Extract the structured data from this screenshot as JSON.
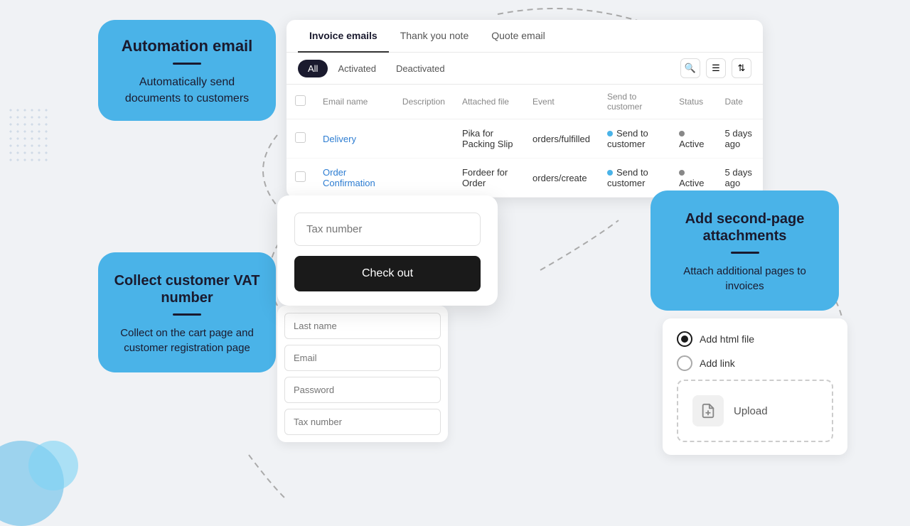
{
  "automation": {
    "label_title": "Automation email",
    "label_desc": "Automatically send documents to customers",
    "panel": {
      "tabs": [
        {
          "label": "Invoice emails",
          "active": true
        },
        {
          "label": "Thank you note",
          "active": false
        },
        {
          "label": "Quote email",
          "active": false
        }
      ],
      "filters": [
        {
          "label": "All",
          "active": true
        },
        {
          "label": "Activated",
          "active": false
        },
        {
          "label": "Deactivated",
          "active": false
        }
      ],
      "columns": [
        "Email name",
        "Description",
        "Attached file",
        "Event",
        "Send to customer",
        "Status",
        "Date"
      ],
      "rows": [
        {
          "name": "Delivery",
          "description": "",
          "attached_file": "Pika for Packing Slip",
          "event": "orders/fulfilled",
          "send_to": "Send to customer",
          "status": "Active",
          "date": "5 days ago"
        },
        {
          "name": "Order Confirmation",
          "description": "",
          "attached_file": "Fordeer for Order",
          "event": "orders/create",
          "send_to": "Send to customer",
          "status": "Active",
          "date": "5 days ago"
        }
      ]
    }
  },
  "vat": {
    "label_title": "Collect customer VAT number",
    "label_desc": "Collect on the cart page and customer registration page",
    "checkout_form": {
      "tax_placeholder": "Tax number",
      "checkout_btn": "Check out"
    },
    "registration_form": {
      "fields": [
        "Last name",
        "Email",
        "Password",
        "Tax number"
      ]
    }
  },
  "attachments": {
    "label_title": "Add second-page attachments",
    "label_desc": "Attach additional pages to invoices",
    "options": [
      {
        "label": "Add html file",
        "selected": true
      },
      {
        "label": "Add link",
        "selected": false
      }
    ],
    "upload_label": "Upload"
  }
}
